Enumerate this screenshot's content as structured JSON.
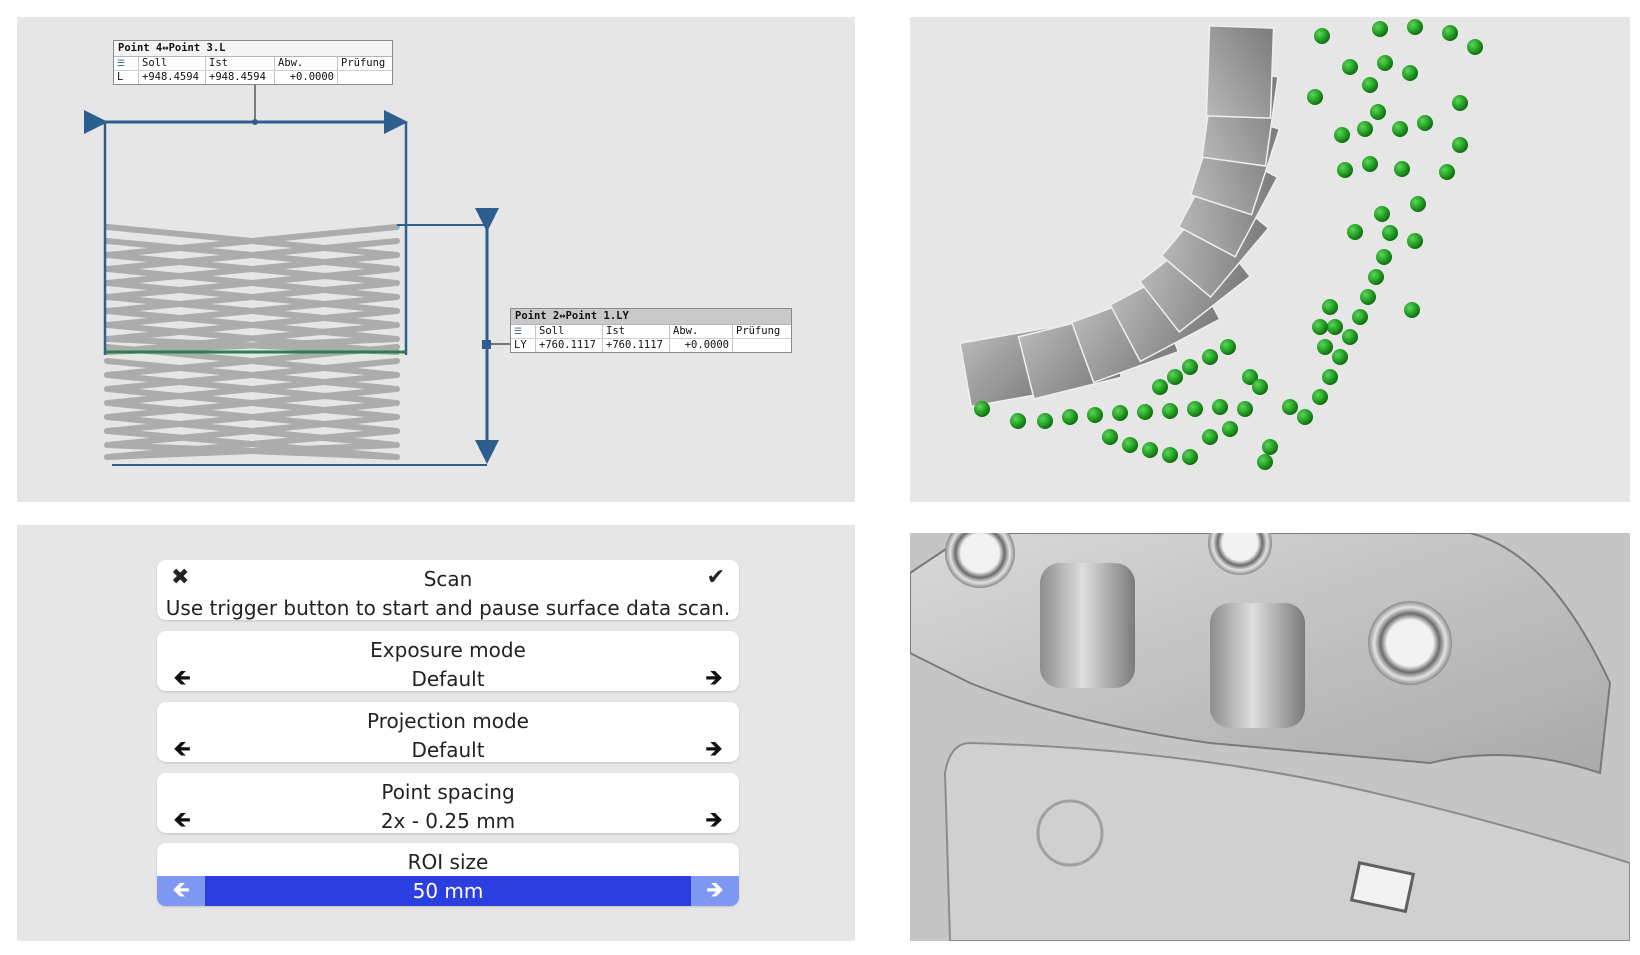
{
  "measurement_view": {
    "length_table": {
      "title": "Point 4↔Point 3.L",
      "headers": [
        "",
        "Soll",
        "Ist",
        "Abw.",
        "Prüfung"
      ],
      "row": [
        "L",
        "+948.4594",
        "+948.4594",
        "+0.0000",
        ""
      ]
    },
    "ly_table": {
      "title": "Point 2↔Point 1.LY",
      "headers": [
        "",
        "Soll",
        "Ist",
        "Abw.",
        "Prüfung"
      ],
      "row": [
        "LY",
        "+760.1117",
        "+760.1117",
        "+0.0000",
        ""
      ]
    },
    "colors": {
      "dimension_line": "#2d5f8e",
      "reference_line": "#2e7d4f",
      "mesh": "#a9a9a9"
    }
  },
  "scan_view": {
    "colors": {
      "marker": "#24a324",
      "marker_dark": "#146e14",
      "image_tile": "#8f8f8f"
    }
  },
  "scanner_menu": {
    "scan": {
      "title": "Scan",
      "hint": "Use trigger button to start and pause surface data scan.",
      "close_icon": "✖",
      "confirm_icon": "✔"
    },
    "settings": [
      {
        "title": "Exposure mode",
        "value": "Default"
      },
      {
        "title": "Projection mode",
        "value": "Default"
      },
      {
        "title": "Point spacing",
        "value": "2x - 0.25 mm"
      }
    ],
    "roi": {
      "title": "ROI size",
      "value": "50 mm"
    },
    "arrow_left": "🡸",
    "arrow_right": "🡺",
    "colors": {
      "selected": "#2b3fe0",
      "selected_arrows": "#7e98f4"
    }
  },
  "surface_view": {
    "colors": {
      "surface": "#c8c8c8",
      "shadow": "#6e6e6e"
    }
  }
}
